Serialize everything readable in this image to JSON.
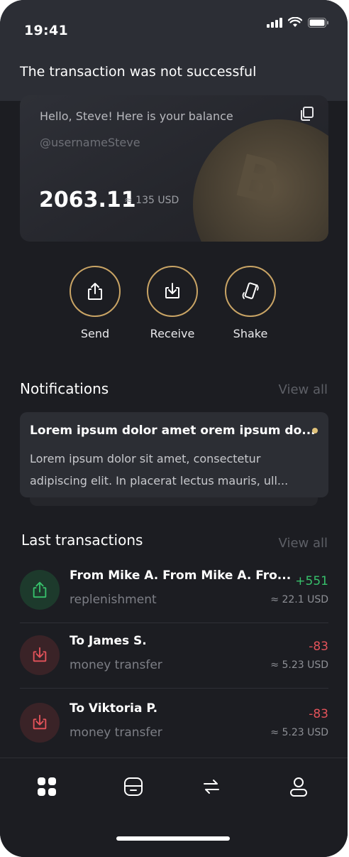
{
  "status_bar": {
    "time": "19:41"
  },
  "toast": {
    "message": "The transaction was not successful"
  },
  "balance_card": {
    "greeting": "Hello, Steve! Here is your balance",
    "username": "@usernameSteve",
    "balance": "2063.11",
    "balance_usd": "≈ 135 USD"
  },
  "actions": [
    {
      "label": "Send",
      "icon": "upload-icon"
    },
    {
      "label": "Receive",
      "icon": "download-icon"
    },
    {
      "label": "Shake",
      "icon": "shake-phone-icon"
    }
  ],
  "notifications": {
    "title": "Notifications",
    "view_all": "View all",
    "items": [
      {
        "title": "Lorem ipsum dolor amet orem ipsum do...",
        "body_line1": "Lorem ipsum dolor sit amet, consectetur",
        "body_line2": "adipiscing elit. In placerat lectus mauris, ull...",
        "unread": true
      }
    ]
  },
  "transactions": {
    "title": "Last transactions",
    "view_all": "View all",
    "items": [
      {
        "name": "From Mike A. From Mike A. Fro...",
        "type": "replenishment",
        "amount": "+551",
        "usd": "≈ 22.1 USD",
        "direction": "incoming"
      },
      {
        "name": "To James S.",
        "type": "money transfer",
        "amount": "-83",
        "usd": "≈ 5.23 USD",
        "direction": "outgoing"
      },
      {
        "name": "To Viktoria P.",
        "type": "money transfer",
        "amount": "-83",
        "usd": "≈ 5.23 USD",
        "direction": "outgoing"
      }
    ]
  },
  "tab_bar": [
    {
      "icon": "grid-icon",
      "active": true
    },
    {
      "icon": "wallet-icon",
      "active": false
    },
    {
      "icon": "exchange-icon",
      "active": false
    },
    {
      "icon": "profile-icon",
      "active": false
    }
  ],
  "colors": {
    "background": "#1c1d22",
    "accent_gold": "#c9a465",
    "positive": "#37c06b",
    "negative": "#e4535a"
  }
}
